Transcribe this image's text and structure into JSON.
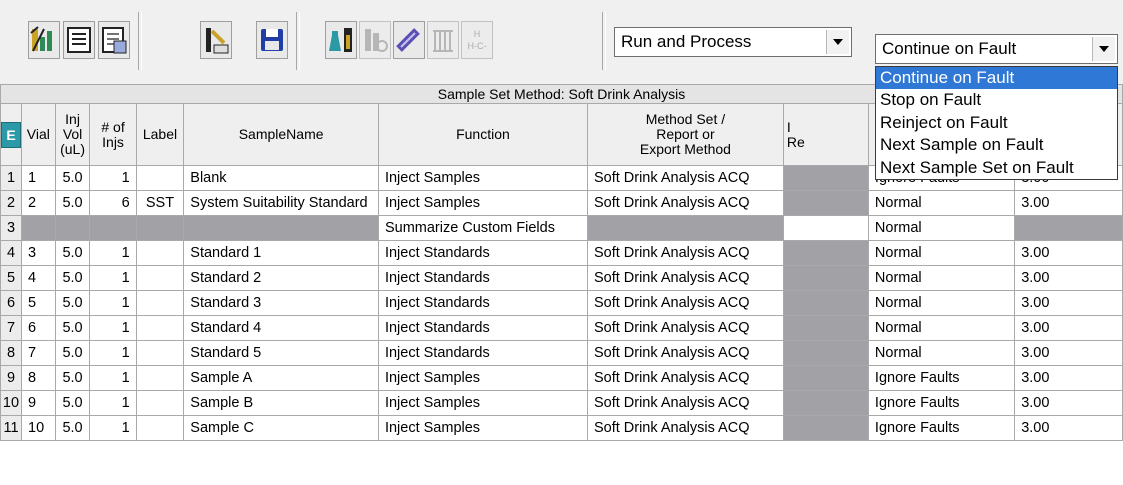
{
  "toolbar": {
    "buttons": [
      {
        "icon": "wizard-chart-icon"
      },
      {
        "icon": "sample-set-icon"
      },
      {
        "icon": "sample-set-copy-icon"
      },
      {
        "icon": "load-vial-icon"
      },
      {
        "icon": "save-floppy-icon"
      },
      {
        "icon": "instrument-flask-icon"
      },
      {
        "icon": "instrument-flask-disabled-icon"
      },
      {
        "icon": "column-icon"
      },
      {
        "icon": "detector-icon"
      },
      {
        "icon": "formula-icon"
      }
    ],
    "mode_combo": {
      "value": "Run and Process"
    },
    "fault_combo": {
      "value": "Continue on Fault"
    }
  },
  "fault_dropdown": {
    "options": [
      "Continue on Fault",
      "Stop on Fault",
      "Reinject on Fault",
      "Next Sample on Fault",
      "Next Sample Set on Fault"
    ],
    "selected_index": 0
  },
  "grid": {
    "title": "Sample Set Method: Soft Drink Analysis",
    "columns": [
      "",
      "Vial",
      "Inj\nVol\n(uL)",
      "# of\nInjs",
      "Label",
      "SampleName",
      "Function",
      "Method Set /\nReport or\nExport Method",
      "I\nRe",
      "",
      ""
    ],
    "rows": [
      {
        "n": "1",
        "vial": "1",
        "vol": "5.0",
        "injs": "1",
        "label": "",
        "name": "Blank",
        "func": "Inject Samples",
        "method": "Soft Drink Analysis ACQ",
        "fault": "Ignore Faults",
        "time": "3.00"
      },
      {
        "n": "2",
        "vial": "2",
        "vol": "5.0",
        "injs": "6",
        "label": "SST",
        "name": "System Suitability Standard",
        "func": "Inject Samples",
        "method": "Soft Drink Analysis ACQ",
        "fault": "Normal",
        "time": "3.00"
      },
      {
        "n": "3",
        "vial": "",
        "vol": "",
        "injs": "",
        "label": "",
        "name": "",
        "func": "Summarize Custom Fields",
        "method": "",
        "fault": "Normal",
        "time": ""
      },
      {
        "n": "4",
        "vial": "3",
        "vol": "5.0",
        "injs": "1",
        "label": "",
        "name": "Standard 1",
        "func": "Inject Standards",
        "method": "Soft Drink Analysis ACQ",
        "fault": "Normal",
        "time": "3.00"
      },
      {
        "n": "5",
        "vial": "4",
        "vol": "5.0",
        "injs": "1",
        "label": "",
        "name": "Standard 2",
        "func": "Inject Standards",
        "method": "Soft Drink Analysis ACQ",
        "fault": "Normal",
        "time": "3.00"
      },
      {
        "n": "6",
        "vial": "5",
        "vol": "5.0",
        "injs": "1",
        "label": "",
        "name": "Standard 3",
        "func": "Inject Standards",
        "method": "Soft Drink Analysis ACQ",
        "fault": "Normal",
        "time": "3.00"
      },
      {
        "n": "7",
        "vial": "6",
        "vol": "5.0",
        "injs": "1",
        "label": "",
        "name": "Standard 4",
        "func": "Inject Standards",
        "method": "Soft Drink Analysis ACQ",
        "fault": "Normal",
        "time": "3.00"
      },
      {
        "n": "8",
        "vial": "7",
        "vol": "5.0",
        "injs": "1",
        "label": "",
        "name": "Standard 5",
        "func": "Inject Standards",
        "method": "Soft Drink Analysis ACQ",
        "fault": "Normal",
        "time": "3.00"
      },
      {
        "n": "9",
        "vial": "8",
        "vol": "5.0",
        "injs": "1",
        "label": "",
        "name": "Sample A",
        "func": "Inject Samples",
        "method": "Soft Drink Analysis ACQ",
        "fault": "Ignore Faults",
        "time": "3.00"
      },
      {
        "n": "10",
        "vial": "9",
        "vol": "5.0",
        "injs": "1",
        "label": "",
        "name": "Sample B",
        "func": "Inject Samples",
        "method": "Soft Drink Analysis ACQ",
        "fault": "Ignore Faults",
        "time": "3.00"
      },
      {
        "n": "11",
        "vial": "10",
        "vol": "5.0",
        "injs": "1",
        "label": "",
        "name": "Sample C",
        "func": "Inject Samples",
        "method": "Soft Drink Analysis ACQ",
        "fault": "Ignore Faults",
        "time": "3.00"
      }
    ]
  },
  "colors": {
    "selection": "#2f78d6",
    "disabled_cell": "#a2a2a6",
    "icon_teal": "#2c9aa6"
  }
}
